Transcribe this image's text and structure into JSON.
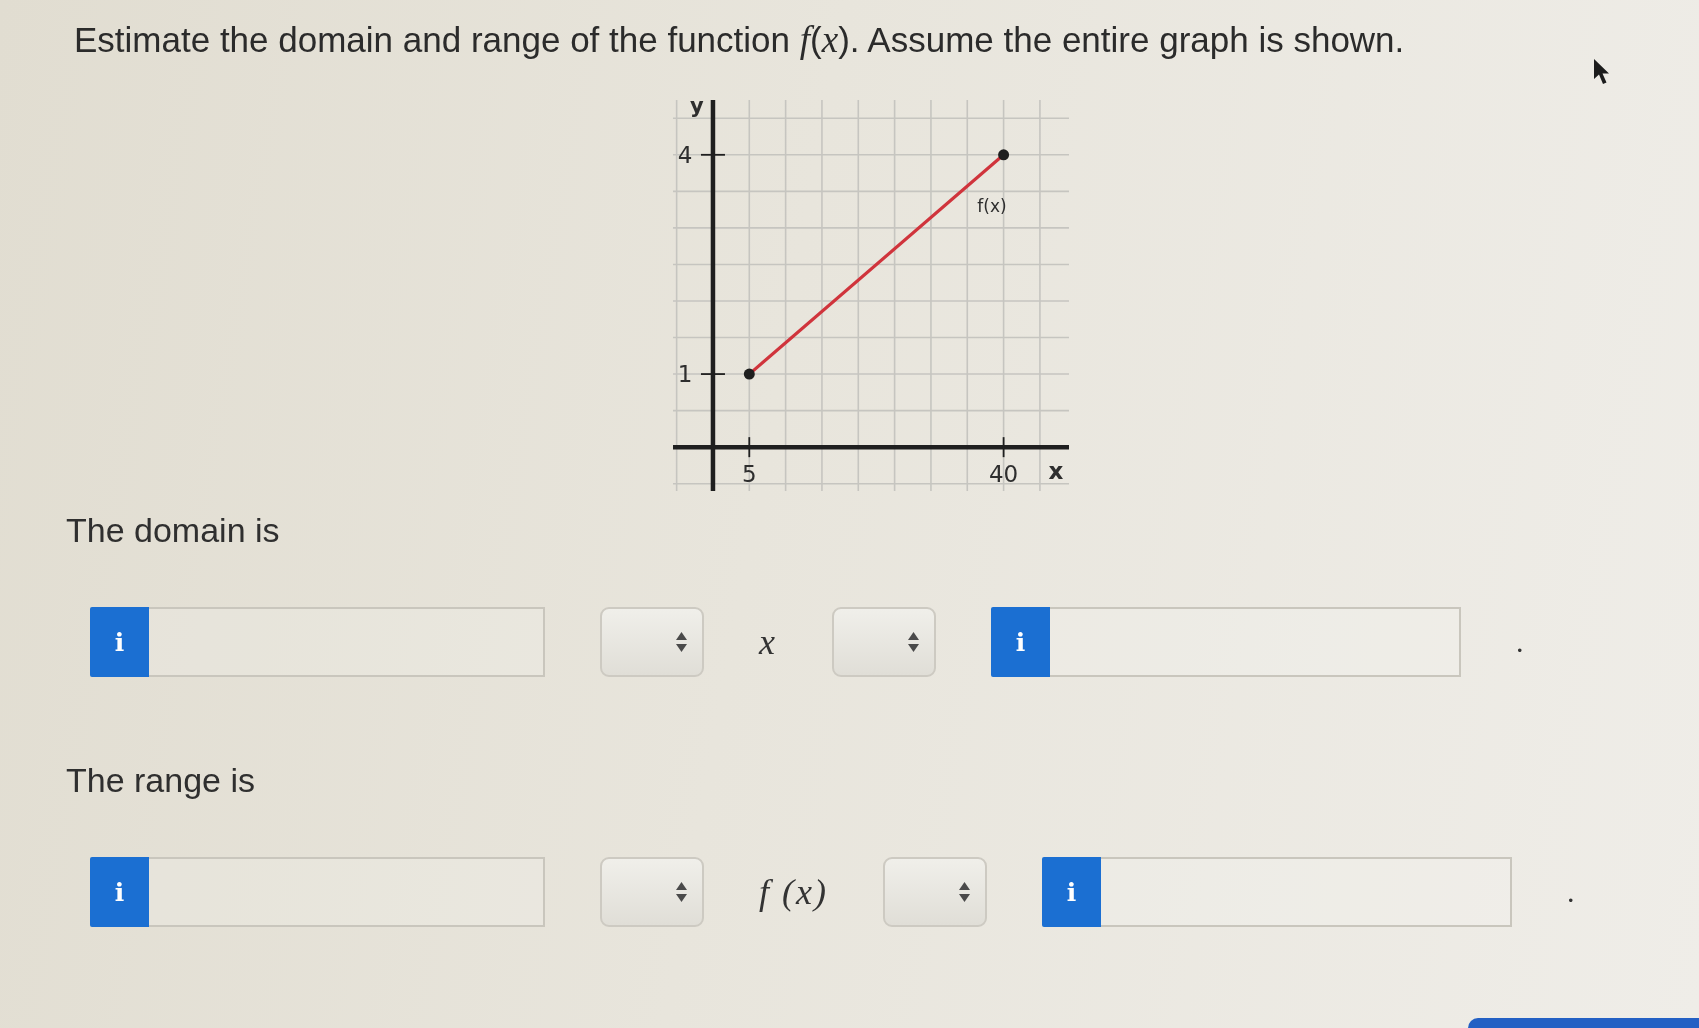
{
  "question": {
    "text": "Estimate the domain and range of the function *f*(*x*). Assume the entire graph is shown."
  },
  "graph": {
    "chart_data": [
      {
        "type": "line",
        "x": [
          5,
          40
        ],
        "values": [
          1,
          4
        ],
        "color": "#d0343c",
        "marker": "circle",
        "xlabel": "x",
        "ylabel": "y",
        "xticks": [
          5,
          40
        ],
        "yticks": [
          1,
          4
        ],
        "xlim": [
          -5.5,
          49
        ],
        "ylim": [
          -0.6,
          4.75
        ],
        "grid": true,
        "annotations": [
          "f(x)"
        ]
      }
    ]
  },
  "domain": {
    "label": "The domain is",
    "items": [
      {
        "kind": "answer",
        "tab": "i"
      },
      {
        "kind": "select"
      },
      {
        "kind": "math",
        "text": "x"
      },
      {
        "kind": "select"
      },
      {
        "kind": "answer",
        "tab": "i"
      },
      {
        "kind": "text",
        "text": "."
      }
    ]
  },
  "range": {
    "label": "The range is",
    "items": [
      {
        "kind": "answer",
        "tab": "i"
      },
      {
        "kind": "select"
      },
      {
        "kind": "math",
        "text": "f (x)"
      },
      {
        "kind": "select"
      },
      {
        "kind": "answer",
        "tab": "i"
      },
      {
        "kind": "text",
        "text": "."
      }
    ]
  }
}
